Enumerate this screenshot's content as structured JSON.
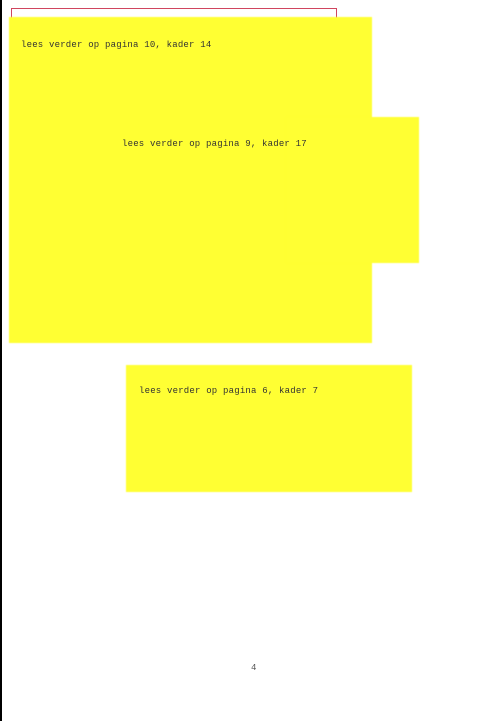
{
  "notes": [
    {
      "text": "lees verder op pagina 10, kader 14"
    },
    {
      "text": "lees verder op pagina 9, kader 17"
    },
    {
      "text": "lees verder op pagina 6, kader 7"
    }
  ],
  "footer": {
    "page_number": "4"
  },
  "colors": {
    "highlight": "#ffff33",
    "frame": "#d0455f"
  }
}
